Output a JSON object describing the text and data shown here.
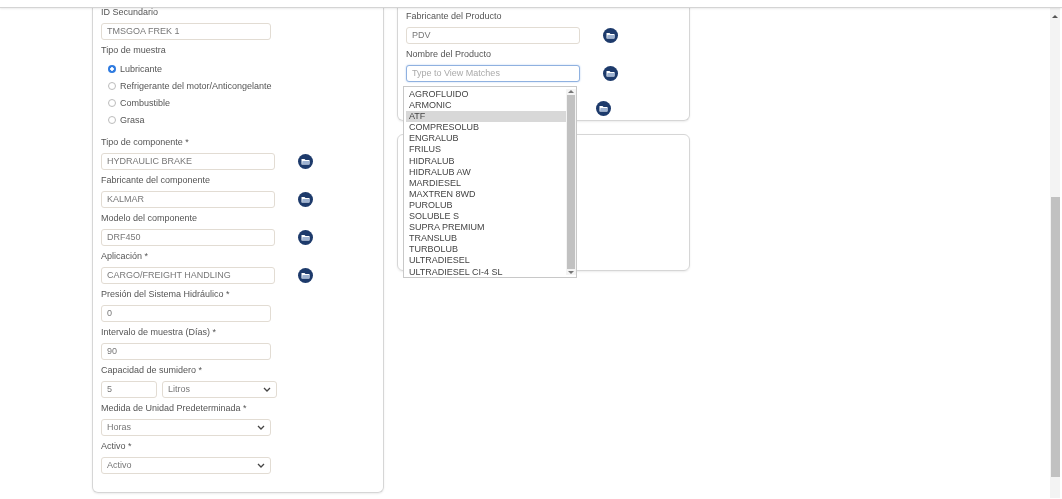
{
  "sample_form": {
    "fields": [
      {
        "kind": "text",
        "label": "ID Secundario",
        "value": "TMSGOA FREK 1"
      },
      {
        "kind": "radio",
        "label": "Tipo de muestra",
        "options": [
          {
            "label": "Lubricante",
            "selected": true
          },
          {
            "label": "Refrigerante del motor/Anticongelante",
            "selected": false
          },
          {
            "label": "Combustible",
            "selected": false
          },
          {
            "label": "Grasa",
            "selected": false
          }
        ]
      },
      {
        "kind": "lookup",
        "label": "Tipo de componente *",
        "value": "HYDRAULIC BRAKE"
      },
      {
        "kind": "lookup",
        "label": "Fabricante del componente",
        "value": "KALMAR"
      },
      {
        "kind": "lookup",
        "label": "Modelo del componente",
        "value": "DRF450"
      },
      {
        "kind": "lookup",
        "label": "Aplicación *",
        "value": "CARGO/FREIGHT HANDLING"
      },
      {
        "kind": "text",
        "label": "Presión del Sistema Hidráulico *",
        "value": "0"
      },
      {
        "kind": "text",
        "label": "Intervalo de muestra (Días) *",
        "value": "90"
      },
      {
        "kind": "amount",
        "label": "Capacidad de sumidero *",
        "value": "5",
        "unit": "Litros"
      },
      {
        "kind": "select",
        "label": "Medida de Unidad Predeterminada *",
        "value": "Horas"
      },
      {
        "kind": "select",
        "label": "Activo *",
        "value": "Activo"
      }
    ]
  },
  "product_form": {
    "fields": [
      {
        "kind": "lookup",
        "label": "Fabricante del Producto",
        "value": "PDV",
        "focused": false
      },
      {
        "kind": "lookup",
        "label": "Nombre del Producto",
        "placeholder": "Type to View Matches",
        "focused": true
      },
      {
        "kind": "covered"
      }
    ]
  },
  "product_matches": {
    "options": [
      {
        "label": "AGROFLUIDO",
        "selected": false
      },
      {
        "label": "ARMONIC",
        "selected": false
      },
      {
        "label": "ATF",
        "selected": true
      },
      {
        "label": "COMPRESOLUB",
        "selected": false
      },
      {
        "label": "ENGRALUB",
        "selected": false
      },
      {
        "label": "FRILUS",
        "selected": false
      },
      {
        "label": "HIDRALUB",
        "selected": false
      },
      {
        "label": "HIDRALUB AW",
        "selected": false
      },
      {
        "label": "MARDIESEL",
        "selected": false
      },
      {
        "label": "MAXTREN 8WD",
        "selected": false
      },
      {
        "label": "PUROLUB",
        "selected": false
      },
      {
        "label": "SOLUBLE S",
        "selected": false
      },
      {
        "label": "SUPRA PREMIUM",
        "selected": false
      },
      {
        "label": "TRANSLUB",
        "selected": false
      },
      {
        "label": "TURBOLUB",
        "selected": false
      },
      {
        "label": "ULTRADIESEL",
        "selected": false
      },
      {
        "label": "ULTRADIESEL CI-4 SL",
        "selected": false
      }
    ]
  }
}
